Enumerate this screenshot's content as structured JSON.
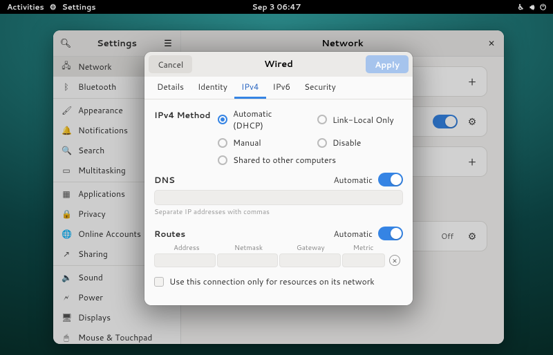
{
  "topbar": {
    "activities": "Activities",
    "app_label": "Settings",
    "clock": "Sep 3  06:47"
  },
  "settings_window": {
    "sidebar_title": "Settings",
    "content_title": "Network",
    "sidebar": {
      "items": [
        {
          "label": "Network",
          "icon": "🖧",
          "active": true
        },
        {
          "label": "Bluetooth",
          "icon": "ᛒ",
          "sep_after": true
        },
        {
          "label": "Appearance",
          "icon": "🖌"
        },
        {
          "label": "Notifications",
          "icon": "🔔"
        },
        {
          "label": "Search",
          "icon": "🔍"
        },
        {
          "label": "Multitasking",
          "icon": "▭",
          "sep_after": true
        },
        {
          "label": "Applications",
          "icon": "▦"
        },
        {
          "label": "Privacy",
          "icon": "🔒"
        },
        {
          "label": "Online Accounts",
          "icon": "🌐"
        },
        {
          "label": "Sharing",
          "icon": "↗",
          "sep_after": true
        },
        {
          "label": "Sound",
          "icon": "🔈"
        },
        {
          "label": "Power",
          "icon": "🗲"
        },
        {
          "label": "Displays",
          "icon": "🖥"
        },
        {
          "label": "Mouse & Touchpad",
          "icon": "🖱"
        }
      ]
    },
    "content": {
      "vpn_off_label": "Off"
    }
  },
  "modal": {
    "cancel_label": "Cancel",
    "apply_label": "Apply",
    "title": "Wired",
    "tabs": [
      "Details",
      "Identity",
      "IPv4",
      "IPv6",
      "Security"
    ],
    "active_tab": "IPv4",
    "ipv4": {
      "method_label": "IPv4 Method",
      "options": {
        "auto": "Automatic (DHCP)",
        "link": "Link-Local Only",
        "manual": "Manual",
        "disable": "Disable",
        "shared": "Shared to other computers"
      },
      "selected": "auto",
      "dns_label": "DNS",
      "automatic_label": "Automatic",
      "dns_help": "Separate IP addresses with commas",
      "routes_label": "Routes",
      "routes_headers": {
        "address": "Address",
        "netmask": "Netmask",
        "gateway": "Gateway",
        "metric": "Metric"
      },
      "restrict_label": "Use this connection only for resources on its network"
    }
  }
}
